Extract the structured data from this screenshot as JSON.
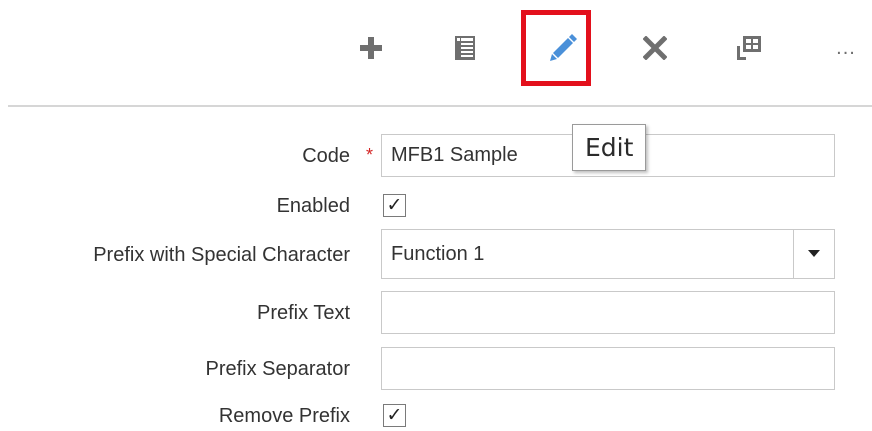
{
  "toolbar": {
    "buttons": [
      {
        "name": "add-button",
        "icon": "plus-icon"
      },
      {
        "name": "view-details-button",
        "icon": "details-list-icon"
      },
      {
        "name": "edit-button",
        "icon": "pencil-icon",
        "highlighted": true
      },
      {
        "name": "delete-button",
        "icon": "close-x-icon"
      },
      {
        "name": "freeze-button",
        "icon": "freeze-table-icon"
      },
      {
        "name": "more-actions-button",
        "icon": "ellipsis-icon"
      }
    ],
    "more_label": "...",
    "highlight_color": "#e3101c",
    "edit_icon_color": "#4a90d9",
    "icon_color": "#6f6f6f"
  },
  "tooltip": {
    "text": "Edit"
  },
  "form": {
    "code": {
      "label": "Code",
      "required_marker": "*",
      "value": "MFB1 Sample"
    },
    "enabled": {
      "label": "Enabled",
      "checked": true,
      "check_glyph": "✓"
    },
    "prefix_special_char": {
      "label": "Prefix with Special Character",
      "value": "Function 1"
    },
    "prefix_text": {
      "label": "Prefix Text",
      "value": ""
    },
    "prefix_separator": {
      "label": "Prefix Separator",
      "value": ""
    },
    "remove_prefix": {
      "label": "Remove Prefix",
      "checked": true,
      "check_glyph": "✓"
    }
  }
}
